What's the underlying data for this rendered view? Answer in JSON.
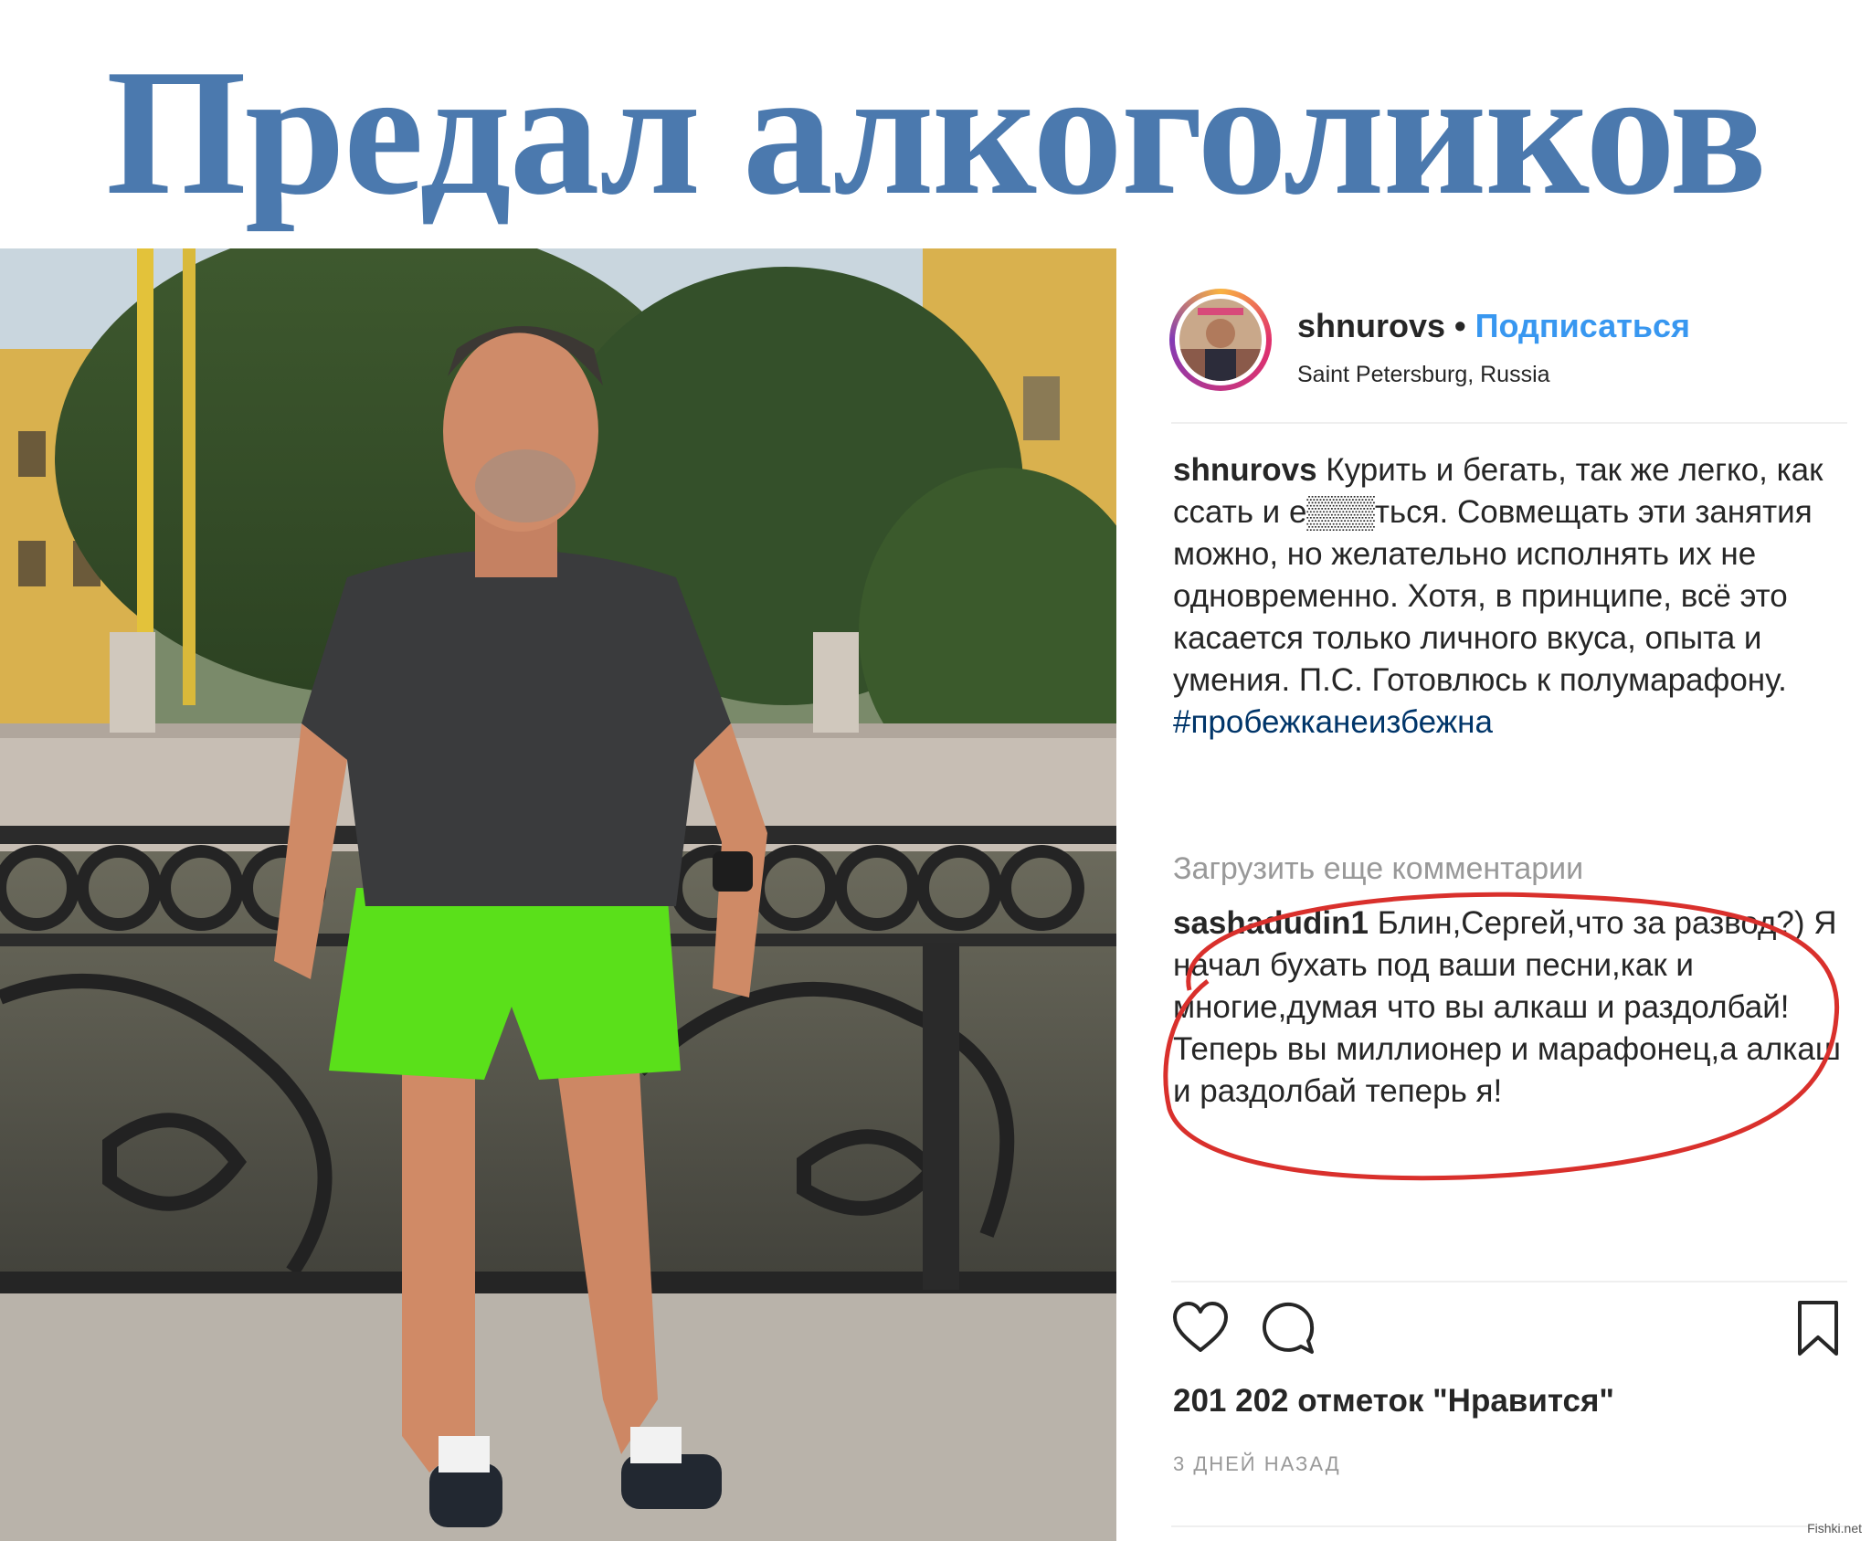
{
  "headline": "Предал алкоголиков",
  "post": {
    "username": "shnurovs",
    "separator": "•",
    "follow_label": "Подписаться",
    "location": "Saint Petersburg, Russia",
    "caption_username": "shnurovs",
    "caption_text": "Курить и бегать, так же легко, как ссать и е▒▒▒ться. Совмещать эти занятия можно, но желательно исполнять их не одновременно. Хотя, в принципе, всё это касается только личного вкуса, опыта и умения. П.С. Готовлюсь к полумарафону.",
    "hashtag": "#пробежканеизбежна",
    "load_more_label": "Загрузить еще комментарии",
    "comment": {
      "username": "sashadudin1",
      "text": "Блин,Сергей,что за развод?) Я начал бухать под ваши песни,как и многие,думая что вы алкаш и раздолбай! Теперь вы миллионер и марафонец,а алкаш и раздолбай теперь я!"
    },
    "likes": "201 202 отметок \"Нравится\"",
    "time_ago": "3 ДНЕЙ НАЗАД"
  },
  "icons": {
    "like": "heart-icon",
    "comment": "comment-icon",
    "save": "bookmark-icon"
  },
  "colors": {
    "headline": "#4b79ae",
    "follow": "#3897f0",
    "hashtag": "#003569",
    "highlight_circle": "#d9302c",
    "muted": "#999999"
  },
  "watermark": "Fishki.net"
}
